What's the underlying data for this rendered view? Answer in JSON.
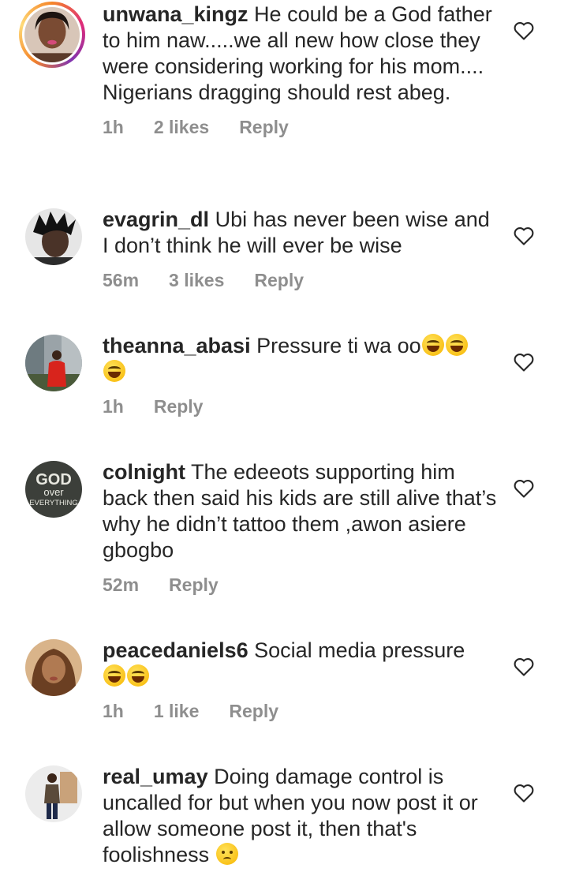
{
  "comments": [
    {
      "username": "unwana_kingz",
      "text": "He could be a God father to him naw.....we all new how close they were considering working for his mom.... Nigerians dragging should rest abeg.",
      "emojis": [],
      "time": "1h",
      "likes": "2 likes",
      "reply": "Reply"
    },
    {
      "username": "evagrin_dl",
      "text": "Ubi has never been wise and I don’t think he will ever be wise",
      "emojis": [],
      "time": "56m",
      "likes": "3 likes",
      "reply": "Reply"
    },
    {
      "username": "theanna_abasi",
      "text": "Pressure ti wa oo",
      "emojis": [
        "laughing-tears",
        "laughing-tears",
        "laughing-tears"
      ],
      "time": "1h",
      "likes": "",
      "reply": "Reply"
    },
    {
      "username": "colnight",
      "text": "The edeeots supporting him back then said his kids are still alive that’s why he didn’t tattoo them ,awon asiere gbogbo",
      "emojis": [],
      "time": "52m",
      "likes": "",
      "reply": "Reply",
      "avatar_text": [
        "GOD",
        "over",
        "EVERYTHING"
      ]
    },
    {
      "username": "peacedaniels6",
      "text": "Social media pressure",
      "emojis": [
        "laughing-tears",
        "laughing-tears"
      ],
      "time": "1h",
      "likes": "1 like",
      "reply": "Reply"
    },
    {
      "username": "real_umay",
      "text": "Doing damage control is uncalled for but when you now post it or allow someone post it, then that's foolishness",
      "emojis": [
        "crying"
      ],
      "time": "",
      "likes": "",
      "reply": ""
    }
  ],
  "icons": {
    "like": "heart-outline-icon"
  },
  "colors": {
    "text": "#262626",
    "meta": "#8e8e8e"
  }
}
